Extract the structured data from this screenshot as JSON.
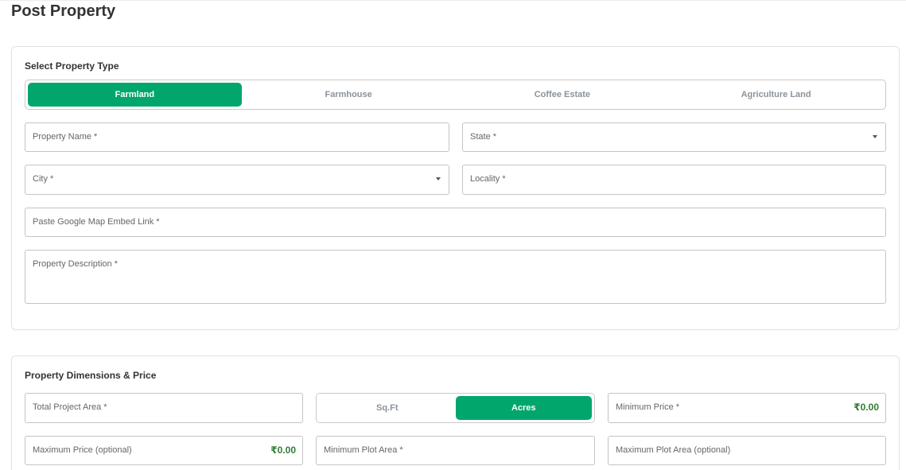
{
  "page": {
    "title": "Post Property"
  },
  "property_type": {
    "section_title": "Select Property Type",
    "options": [
      "Farmland",
      "Farmhouse",
      "Coffee Estate",
      "Agriculture Land"
    ],
    "selected": "Farmland"
  },
  "details": {
    "property_name": "Property Name *",
    "state": "State *",
    "city": "City *",
    "locality": "Locality *",
    "map_link": "Paste Google Map Embed Link *",
    "description": "Property Description *"
  },
  "dimensions": {
    "section_title": "Property Dimensions & Price",
    "total_area": "Total Project Area *",
    "unit_options": [
      "Sq.Ft",
      "Acres"
    ],
    "unit_selected": "Acres",
    "min_price": "Minimum Price *",
    "min_price_value": "₹0.00",
    "max_price": "Maximum Price (optional)",
    "max_price_value": "₹0.00",
    "min_plot": "Minimum Plot Area *",
    "max_plot": "Maximum Plot Area (optional)"
  },
  "colors": {
    "accent": "#00a66c",
    "price": "#2e7d32"
  }
}
